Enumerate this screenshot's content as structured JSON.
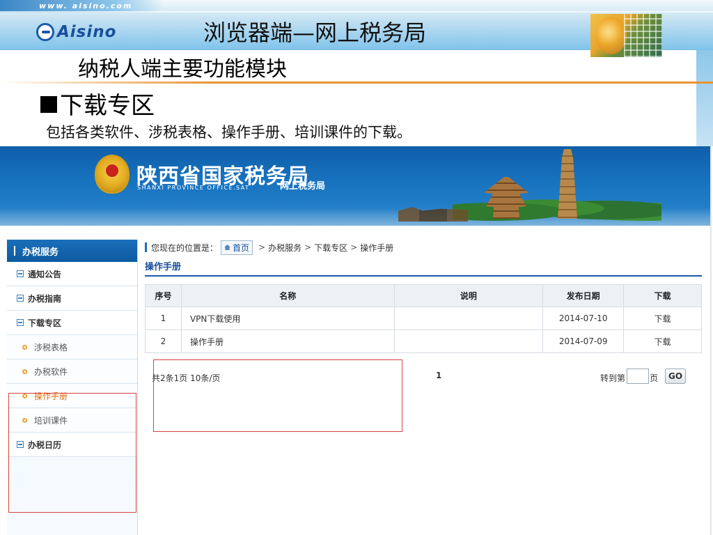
{
  "slide": {
    "url": "www. aisino.com",
    "logo": "Aisino",
    "title": "浏览器端—网上税务局",
    "subtitle": "纳税人端主要功能模块",
    "section": "下载专区",
    "description": "包括各类软件、涉税表格、操作手册、培训课件的下载。"
  },
  "site": {
    "name": "陕西省国家税务局",
    "name_en": "SHANXI PROVINCE OFFICE.SAT",
    "subtitle": "网上税务局"
  },
  "sidebar": {
    "header": "办税服务",
    "items": [
      {
        "label": "通知公告",
        "kind": "section"
      },
      {
        "label": "办税指南",
        "kind": "section"
      },
      {
        "label": "下载专区",
        "kind": "section"
      },
      {
        "label": "涉税表格",
        "kind": "sub"
      },
      {
        "label": "办税软件",
        "kind": "sub"
      },
      {
        "label": "操作手册",
        "kind": "sub",
        "active": true
      },
      {
        "label": "培训课件",
        "kind": "sub"
      },
      {
        "label": "办税日历",
        "kind": "section"
      }
    ]
  },
  "breadcrumb": {
    "prefix": "您现在的位置是：",
    "home": "首页",
    "sep": ">",
    "items": [
      "办税服务",
      "下载专区",
      "操作手册"
    ]
  },
  "main": {
    "heading": "操作手册"
  },
  "table": {
    "columns": [
      "序号",
      "名称",
      "说明",
      "发布日期",
      "下载"
    ],
    "rows": [
      [
        "1",
        "VPN下载使用",
        "",
        "2014-07-10",
        "下载"
      ],
      [
        "2",
        "操作手册",
        "",
        "2014-07-09",
        "下载"
      ]
    ]
  },
  "pager": {
    "summary": "共2条1页 10条/页",
    "current": "1",
    "goto_label": "转到第",
    "page_label": "页",
    "go": "GO"
  },
  "colors": {
    "brand_blue": "#1a5aa8",
    "banner_blue": "#1873bf",
    "active_orange": "#e46f12",
    "highlight_red": "#d8433d"
  }
}
